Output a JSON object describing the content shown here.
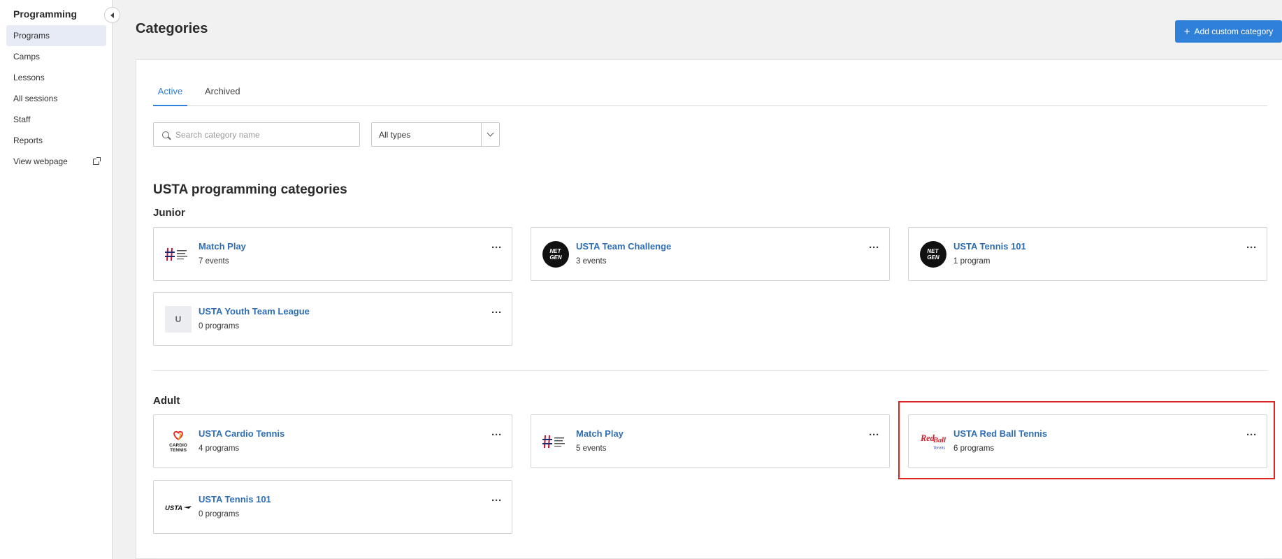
{
  "sidebar": {
    "title": "Programming",
    "items": [
      {
        "label": "Programs"
      },
      {
        "label": "Camps"
      },
      {
        "label": "Lessons"
      },
      {
        "label": "All sessions"
      },
      {
        "label": "Staff"
      },
      {
        "label": "Reports"
      },
      {
        "label": "View webpage"
      }
    ]
  },
  "header": {
    "title": "Categories",
    "add_button": "Add custom category"
  },
  "tabs": [
    "Active",
    "Archived"
  ],
  "filters": {
    "search_placeholder": "Search category name",
    "type_select": "All types"
  },
  "section_title": "USTA programming categories",
  "groups": {
    "junior": {
      "label": "Junior",
      "cards": [
        {
          "name": "Match Play",
          "meta": "7 events",
          "logo": "net-generation-logo"
        },
        {
          "name": "USTA Team Challenge",
          "meta": "3 events",
          "logo": "netgen-circle-logo"
        },
        {
          "name": "USTA Tennis 101",
          "meta": "1 program",
          "logo": "netgen-circle-logo"
        },
        {
          "name": "USTA Youth Team League",
          "meta": "0 programs",
          "logo": "U"
        }
      ]
    },
    "adult": {
      "label": "Adult",
      "cards": [
        {
          "name": "USTA Cardio Tennis",
          "meta": "4 programs",
          "logo": "cardio-tennis-logo"
        },
        {
          "name": "Match Play",
          "meta": "5 events",
          "logo": "net-generation-logo"
        },
        {
          "name": "USTA Red Ball Tennis",
          "meta": "6 programs",
          "logo": "red-ball-logo"
        },
        {
          "name": "USTA Tennis 101",
          "meta": "0 programs",
          "logo": "usta-logo"
        }
      ]
    }
  },
  "colors": {
    "accent": "#2f80d8",
    "link": "#2f6eb5",
    "highlight": "#e02424"
  }
}
